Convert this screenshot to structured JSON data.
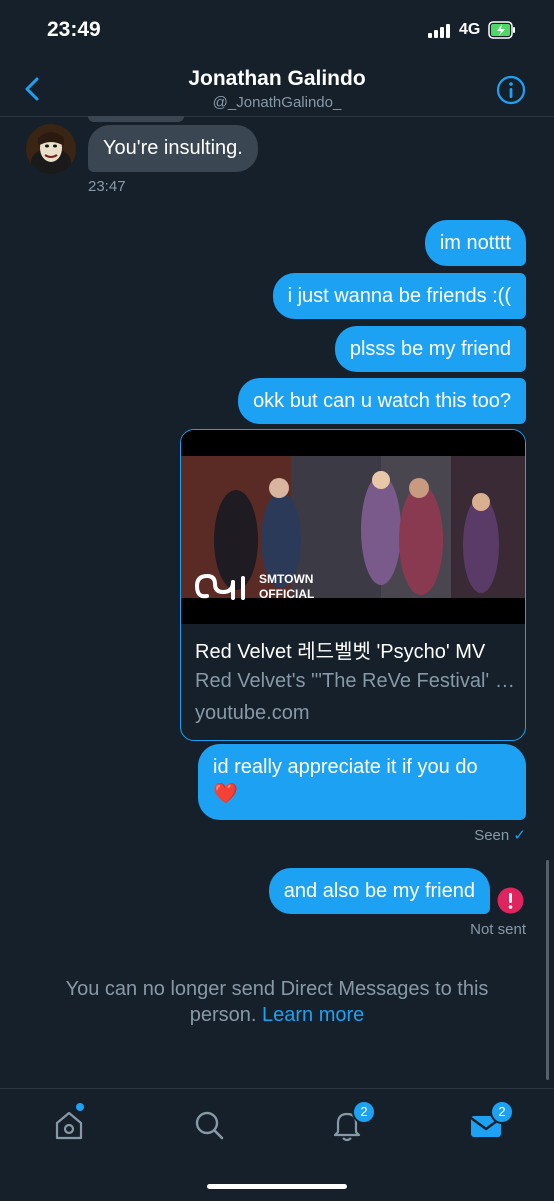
{
  "status_bar": {
    "time": "23:49",
    "network": "4G"
  },
  "header": {
    "name": "Jonathan Galindo",
    "handle": "@_JonathGalindo_"
  },
  "messages": {
    "received": {
      "text": "You're insulting.",
      "timestamp": "23:47"
    },
    "sent": [
      "im notttt",
      "i just wanna be friends :((",
      "plsss be my friend",
      "okk but can u watch this too?"
    ],
    "link_card": {
      "thumbnail_label_line1": "SMTOWN",
      "thumbnail_label_line2": "OFFICIAL",
      "title": "Red Velvet 레드벨벳 'Psycho' MV",
      "description": "Red Velvet's \"'The ReVe Festival' Finale\"",
      "domain": "youtube.com"
    },
    "appreciate": {
      "line1": "id really appreciate it if you do",
      "emoji": "❤️"
    },
    "seen_label": "Seen",
    "last_message": "and also be my friend",
    "not_sent_label": "Not sent"
  },
  "notice": {
    "text": "You can no longer send Direct Messages to this person.",
    "link": "Learn more"
  },
  "tabbar": {
    "notifications_badge": "2",
    "messages_badge": "2"
  },
  "colors": {
    "accent": "#1da1f2",
    "background": "#15202b",
    "incoming_bubble": "#3a4651",
    "error": "#e0245e"
  }
}
